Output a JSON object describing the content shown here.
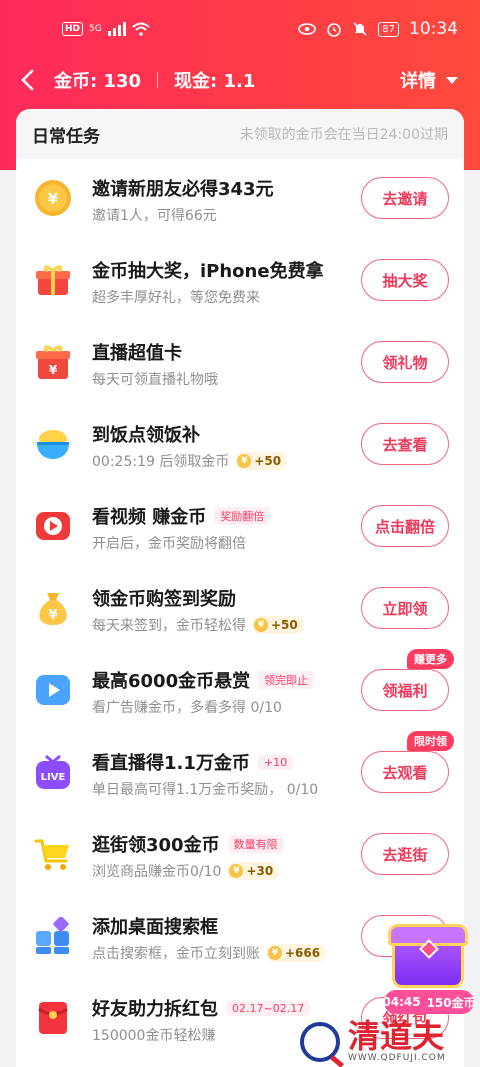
{
  "status": {
    "hd": "HD",
    "net": "5G",
    "battery": "87",
    "time": "10:34"
  },
  "header": {
    "coins_label": "金币: 130",
    "cash_label": "现金: 1.1",
    "detail_label": "详情"
  },
  "card": {
    "title": "日常任务",
    "note": "未领取的金币会在当日24:00过期"
  },
  "tasks": [
    {
      "title": "邀请新朋友必得343元",
      "sub": "邀请1人，可得66元",
      "button": "去邀请",
      "icon": "coin-yuan-icon"
    },
    {
      "title": "金币抽大奖，iPhone免费拿",
      "sub": "超多丰厚好礼，等您免费来",
      "button": "抽大奖",
      "icon": "gift-icon"
    },
    {
      "title": "直播超值卡",
      "sub": "每天可领直播礼物哦",
      "button": "领礼物",
      "icon": "gift-box-yuan-icon"
    },
    {
      "title": "到饭点领饭补",
      "sub": "00:25:19 后领取金币",
      "reward": "+50",
      "button": "去查看",
      "icon": "rice-bowl-icon"
    },
    {
      "title": "看视频 赚金币",
      "tag": "奖励翻倍",
      "sub": "开启后，金币奖励将翻倍",
      "button": "点击翻倍",
      "icon": "video-play-icon"
    },
    {
      "title": "领金币购签到奖励",
      "sub": "每天来签到，金币轻松得",
      "reward": "+50",
      "button": "立即领",
      "icon": "money-bag-icon"
    },
    {
      "title": "最高6000金币悬赏",
      "tag": "领完即止",
      "sub": "看广告赚金币，多看多得 0/10",
      "button": "领福利",
      "bubble": "赚更多",
      "icon": "ad-play-icon"
    },
    {
      "title": "看直播得1.1万金币",
      "tag": "+10",
      "sub": "单日最高可得1.1万金币奖励，  0/10",
      "button": "去观看",
      "bubble": "限时领",
      "icon": "live-tv-icon"
    },
    {
      "title": "逛街领300金币",
      "tag": "数量有限",
      "sub": "浏览商品赚金币0/10",
      "reward": "+30",
      "button": "去逛街",
      "icon": "shopping-cart-icon"
    },
    {
      "title": "添加桌面搜索框",
      "sub": "点击搜索框，金币立刻到账",
      "reward": "+666",
      "button": "去",
      "icon": "app-grid-icon"
    },
    {
      "title": "好友助力拆红包",
      "tag": "02.17~02.17",
      "sub": "150000金币轻松赚",
      "button": "领红包",
      "icon": "red-envelope-icon"
    }
  ],
  "coin_symbol": "¥",
  "chest": {
    "timer": "04:45",
    "reward": "150金币"
  },
  "watermark": {
    "name": "清道夫",
    "url": "WWW.QDFUJI.COM"
  },
  "colors": {
    "accent": "#ff3a55",
    "button_text": "#f03a5c"
  }
}
